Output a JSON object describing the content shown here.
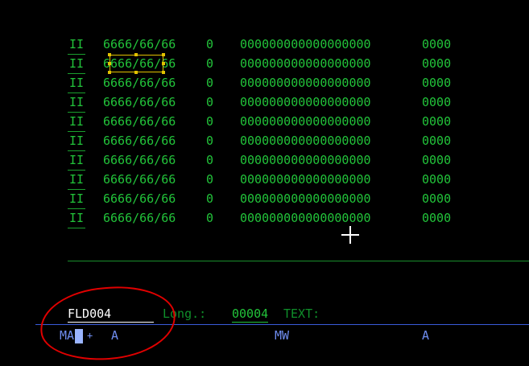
{
  "rows": [
    {
      "flag": "II",
      "date": "6666/66/66",
      "code": "0",
      "serial": "000000000000000000",
      "num": "0000"
    },
    {
      "flag": "II",
      "date": "6666/66/66",
      "code": "0",
      "serial": "000000000000000000",
      "num": "0000"
    },
    {
      "flag": "II",
      "date": "6666/66/66",
      "code": "0",
      "serial": "000000000000000000",
      "num": "0000"
    },
    {
      "flag": "II",
      "date": "6666/66/66",
      "code": "0",
      "serial": "000000000000000000",
      "num": "0000"
    },
    {
      "flag": "II",
      "date": "6666/66/66",
      "code": "0",
      "serial": "000000000000000000",
      "num": "0000"
    },
    {
      "flag": "II",
      "date": "6666/66/66",
      "code": "0",
      "serial": "000000000000000000",
      "num": "0000"
    },
    {
      "flag": "II",
      "date": "6666/66/66",
      "code": "0",
      "serial": "000000000000000000",
      "num": "0000"
    },
    {
      "flag": "II",
      "date": "6666/66/66",
      "code": "0",
      "serial": "000000000000000000",
      "num": "0000"
    },
    {
      "flag": "II",
      "date": "6666/66/66",
      "code": "0",
      "serial": "000000000000000000",
      "num": "0000"
    },
    {
      "flag": "II",
      "date": "6666/66/66",
      "code": "0",
      "serial": "000000000000000000",
      "num": "0000"
    }
  ],
  "field": {
    "name": "FLD004",
    "length_label": "Long.:",
    "length_value": "00004",
    "text_label": "TEXT:"
  },
  "attributes": {
    "ma": "MA",
    "plus": "+",
    "a1": "A",
    "mw": "MW",
    "a2": "A"
  },
  "colors": {
    "background": "#000000",
    "field_text": "#22c33a",
    "attribute_text": "#6f8df0",
    "selection": "#e2c200",
    "annotation": "#e00000"
  }
}
